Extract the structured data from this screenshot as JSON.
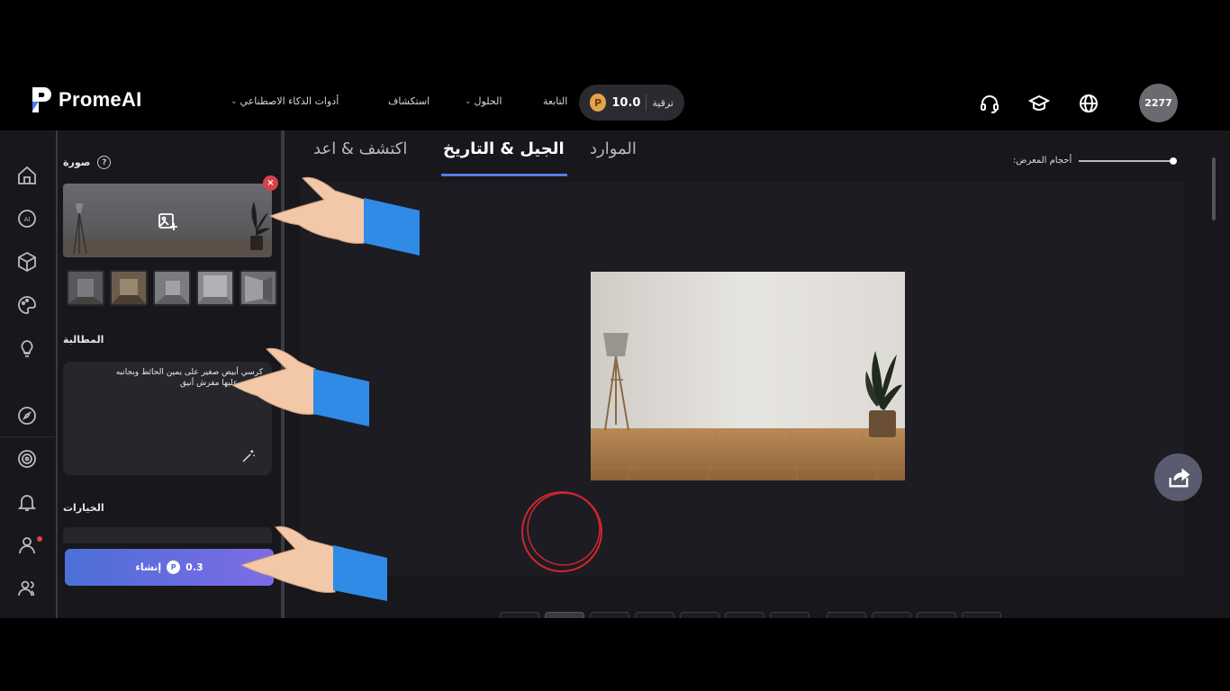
{
  "brand": {
    "name": "PromeAI"
  },
  "nav": {
    "items": [
      {
        "label": "أدوات الذكاء الاصطناعي",
        "dropdown": true
      },
      {
        "label": "استكشاف",
        "dropdown": false
      },
      {
        "label": "الحلول",
        "dropdown": true
      },
      {
        "label": "التابعة",
        "dropdown": false
      }
    ],
    "credits": {
      "value": "10.0",
      "upgrade_label": "ترقية",
      "coin_glyph": "P"
    },
    "user": {
      "avatar_text": "2277"
    },
    "icons": [
      "headset-icon",
      "graduation-cap-icon",
      "globe-icon"
    ]
  },
  "rail": {
    "icons": [
      "home-icon",
      "ai-icon",
      "cube-icon",
      "palette-icon",
      "lightbulb-icon",
      "compass-icon",
      "target-icon",
      "bell-icon",
      "user-icon",
      "community-icon"
    ]
  },
  "panel": {
    "image_section": {
      "title": "صورة",
      "help_glyph": "?",
      "close_glyph": "×"
    },
    "prompt_section": {
      "title": "المطالبة",
      "text_line1": "كرسي أبيض صغير  على يمين الحائط وبجانبه",
      "text_line2": "ترابيزه عليها مفرش أنيق"
    },
    "options_section": {
      "title": "الخيارات"
    },
    "generate": {
      "cost": "0.3",
      "label": "إنشاء"
    }
  },
  "main": {
    "tabs": [
      {
        "label": "اكتشف & اعد",
        "active": false
      },
      {
        "label": "الجيل & التاريخ",
        "active": true
      },
      {
        "label": "الموارد",
        "active": false
      }
    ],
    "gallery_size_label": ":أحجام المعرض",
    "tools_left": [
      "undo-icon",
      "magic-wand-icon",
      "brush-icon",
      "lasso-icon",
      "eraser-icon",
      "redo-icon",
      "checkbox-icon"
    ],
    "tools_right": [
      "move-icon",
      "crop-icon",
      "zoom-in-icon",
      "zoom-out-icon"
    ]
  },
  "colors": {
    "accent": "#5b7ae8",
    "generate_start": "#4c6fd6",
    "generate_end": "#7d6be6",
    "close": "#d9414b",
    "sleeve": "#2f8be6",
    "circle": "#d0262f"
  }
}
